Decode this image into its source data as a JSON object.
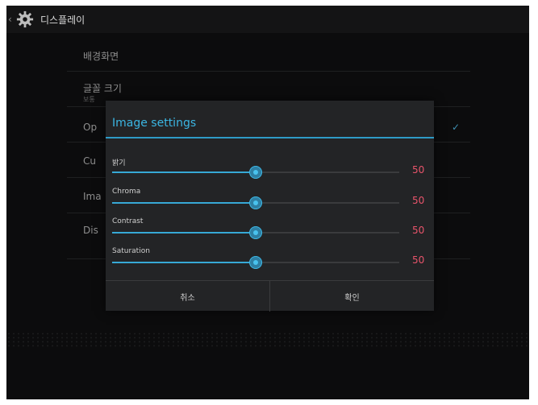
{
  "action_bar": {
    "back_glyph": "‹",
    "icon": "gear-icon",
    "title": "디스플레이"
  },
  "settings": {
    "items": [
      {
        "title": "배경화면",
        "summary": ""
      },
      {
        "title": "글꼴 크기",
        "summary": "보통"
      },
      {
        "title": "Op",
        "summary": "",
        "checked": true
      },
      {
        "title": "Cu",
        "summary": ""
      },
      {
        "title": "Ima",
        "summary": ""
      },
      {
        "title": "Dis",
        "summary": ""
      }
    ],
    "check_glyph": "✓"
  },
  "dialog": {
    "title": "Image settings",
    "sliders": [
      {
        "label": "밝기",
        "value": "50",
        "level": 0.5
      },
      {
        "label": "Chroma",
        "value": "50",
        "level": 0.5
      },
      {
        "label": "Contrast",
        "value": "50",
        "level": 0.5
      },
      {
        "label": "Saturation",
        "value": "50",
        "level": 0.5
      }
    ],
    "cancel_label": "취소",
    "ok_label": "확인"
  },
  "colors": {
    "accent": "#3bb6e3",
    "value_text": "#e8546b"
  }
}
